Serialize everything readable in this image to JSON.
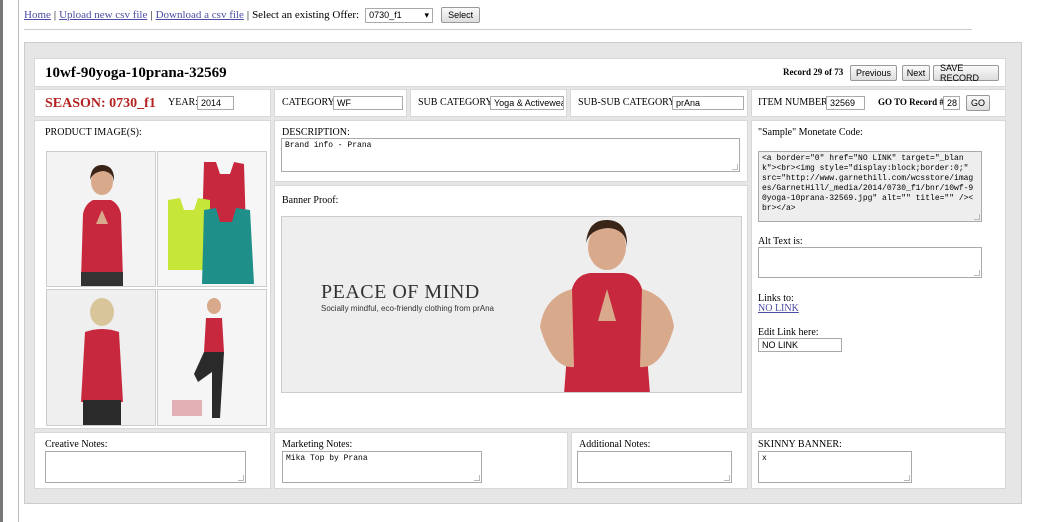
{
  "nav": {
    "home": "Home",
    "upload": "Upload new csv file",
    "download": "Download a csv file",
    "sep": "|",
    "select_prompt": "Select an existing Offer:",
    "offer_value": "0730_f1",
    "select_button": "Select"
  },
  "record": {
    "title": "10wf-90yoga-10prana-32569",
    "position": "Record 29 of 73",
    "previous": "Previous",
    "next": "Next",
    "save": "SAVE RECORD"
  },
  "fields": {
    "season": "SEASON: 0730_f1",
    "year_label": "YEAR:",
    "year": "2014",
    "category_label": "CATEGORY:",
    "category": "WF",
    "sub_category_label": "SUB CATEGORY:",
    "sub_category": "Yoga & Activewear",
    "sub_sub_category_label": "SUB-SUB CATEGORY:",
    "sub_sub_category": "prAna",
    "item_number_label": "ITEM NUMBER:",
    "item_number": "32569",
    "goto_label": "GO TO Record #",
    "goto_value": "28",
    "go_button": "GO"
  },
  "images": {
    "label": "PRODUCT IMAGE(S):"
  },
  "description": {
    "label": "DESCRIPTION:",
    "value": "Brand info - Prana"
  },
  "banner": {
    "label": "Banner Proof:",
    "headline": "PEACE OF MIND",
    "subline": "Socially mindful, eco-friendly clothing from prAna"
  },
  "monetate": {
    "label": "\"Sample\" Monetate Code:",
    "code": "<a border=\"0\" href=\"NO LINK\" target=\"_blank\"><br><img style=\"display:block;border:0;\" src=\"http://www.garnethill.com/wcsstore/images/GarnetHill/_media/2014/0730_f1/bnr/10wf-90yoga-10prana-32569.jpg\" alt=\"\" title=\"\" /><br></a>"
  },
  "alt_text": {
    "label": "Alt Text is:",
    "value": ""
  },
  "links": {
    "label": "Links to:",
    "value": "NO LINK"
  },
  "edit_link": {
    "label": "Edit Link here:",
    "value": "NO LINK"
  },
  "notes": {
    "creative_label": "Creative Notes:",
    "creative": "",
    "marketing_label": "Marketing Notes:",
    "marketing": "Mika Top by Prana",
    "additional_label": "Additional Notes:",
    "additional": "",
    "skinny_label": "SKINNY BANNER:",
    "skinny": "x"
  },
  "colors": {
    "link": "#4c4ca4",
    "season_red": "#b42323",
    "tank_red": "#c8283e",
    "tank_lime": "#c6e63a",
    "tank_teal": "#1f8f8a"
  }
}
